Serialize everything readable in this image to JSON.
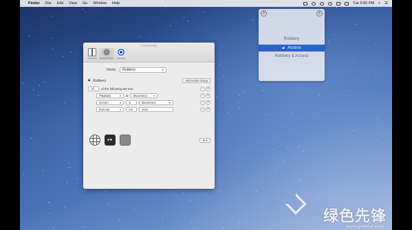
{
  "menubar": {
    "items": [
      "Finder",
      "File",
      "Edit",
      "View",
      "Go",
      "Window",
      "Help"
    ],
    "clock": "Tue 5:55 PM"
  },
  "popover": {
    "items": [
      {
        "label": "Robbery",
        "selected": false
      },
      {
        "label": "Access",
        "selected": true
      },
      {
        "label": "Robbery & Access",
        "selected": false
      }
    ]
  },
  "window": {
    "title": "ActionRelay",
    "toolbar": [
      "General",
      "Action Rules",
      "Markers"
    ],
    "host_label": "Hosts:",
    "host_value": "Robbery",
    "group_name": "Robbery",
    "add_group_label": "Add Action Group",
    "rules": [
      {
        "type": "match",
        "quantifier": "All",
        "text": "of the following are true"
      },
      {
        "type": "cond",
        "a": "Playback",
        "op": "is",
        "b": "disconnect"
      },
      {
        "type": "cond",
        "a": "Screen",
        "op": "is",
        "b": "disconnect"
      },
      {
        "type": "cond",
        "a": "Execute",
        "op": "run",
        "b": "osas"
      }
    ],
    "add_action_label": "⊕ ▾"
  },
  "watermark": {
    "text": "绿色先锋",
    "url": "www.greenxf.com"
  },
  "colors": {
    "selection": "#2a64c8",
    "window_bg": "#ececec"
  }
}
